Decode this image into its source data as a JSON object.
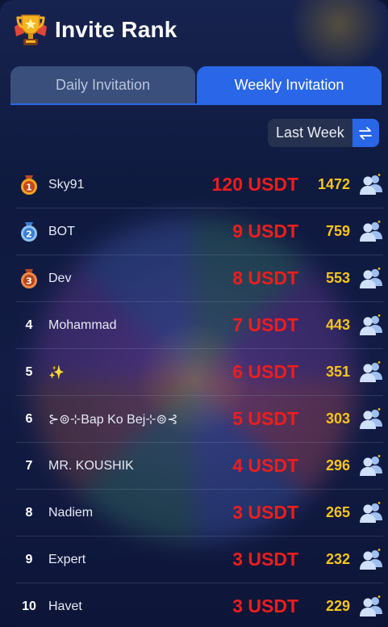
{
  "header": {
    "title": "Invite Rank"
  },
  "tabs": [
    {
      "label": "Daily Invitation",
      "active": false
    },
    {
      "label": "Weekly Invitation",
      "active": true
    }
  ],
  "filter": {
    "period": "Last Week"
  },
  "colors": {
    "accent": "#2a66e8",
    "prize": "#ee1d1d",
    "count": "#f5c518"
  },
  "ranking": [
    {
      "rank": "1",
      "name": "Sky91",
      "prize": "120 USDT",
      "count": "1472",
      "medal": "gold-medal-icon"
    },
    {
      "rank": "2",
      "name": "BOT",
      "prize": "9 USDT",
      "count": "759",
      "medal": "silver-medal-icon"
    },
    {
      "rank": "3",
      "name": "Dev",
      "prize": "8 USDT",
      "count": "553",
      "medal": "bronze-medal-icon"
    },
    {
      "rank": "4",
      "name": "Mohammad",
      "prize": "7 USDT",
      "count": "443"
    },
    {
      "rank": "5",
      "name": "✨",
      "prize": "6 USDT",
      "count": "351"
    },
    {
      "rank": "6",
      "name": "⊱⊚⊹Bap Ko Bej⊹⊚⊰",
      "prize": "5 USDT",
      "count": "303"
    },
    {
      "rank": "7",
      "name": "MR. KOUSHIK",
      "prize": "4 USDT",
      "count": "296"
    },
    {
      "rank": "8",
      "name": "Nadiem",
      "prize": "3 USDT",
      "count": "265"
    },
    {
      "rank": "9",
      "name": "Expert",
      "prize": "3 USDT",
      "count": "232"
    },
    {
      "rank": "10",
      "name": "Havet",
      "prize": "3 USDT",
      "count": "229"
    }
  ]
}
